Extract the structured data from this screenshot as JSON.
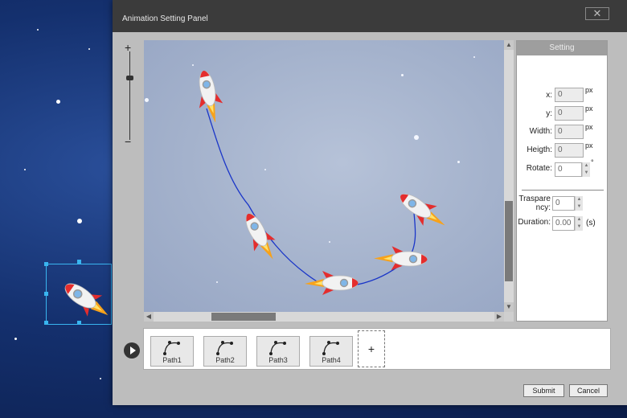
{
  "dialog": {
    "title": "Animation Setting Panel",
    "close_label": "✕"
  },
  "zoom": {
    "plus_label": "+",
    "minus_label": "−",
    "level": 0.3
  },
  "setting": {
    "header": "Setting",
    "fields": {
      "x": {
        "label": "x:",
        "value": "0",
        "unit": "px"
      },
      "y": {
        "label": "y:",
        "value": "0",
        "unit": "px"
      },
      "width": {
        "label": "Width:",
        "value": "0",
        "unit": "px"
      },
      "height": {
        "label": "Heigth:",
        "value": "0",
        "unit": "px"
      },
      "rotate": {
        "label": "Rotate:",
        "value": "0",
        "unit": "°"
      },
      "transparency": {
        "label_line1": "Traspare",
        "label_line2": "ncy:",
        "value": "0"
      },
      "duration": {
        "label": "Duration:",
        "value": "0.00",
        "unit": "(s)"
      }
    }
  },
  "paths": {
    "items": [
      {
        "label": "Path1"
      },
      {
        "label": "Path2"
      },
      {
        "label": "Path3"
      },
      {
        "label": "Path4"
      }
    ],
    "add_label": "+"
  },
  "actions": {
    "submit_label": "Submit",
    "cancel_label": "Cancel"
  },
  "colors": {
    "path_line": "#1a36c8",
    "title_bar": "#3b3b3b",
    "selection": "#39b5f0"
  },
  "icons": {
    "play": "play-circle-icon",
    "path": "bezier-path-icon",
    "rocket": "rocket-icon"
  }
}
